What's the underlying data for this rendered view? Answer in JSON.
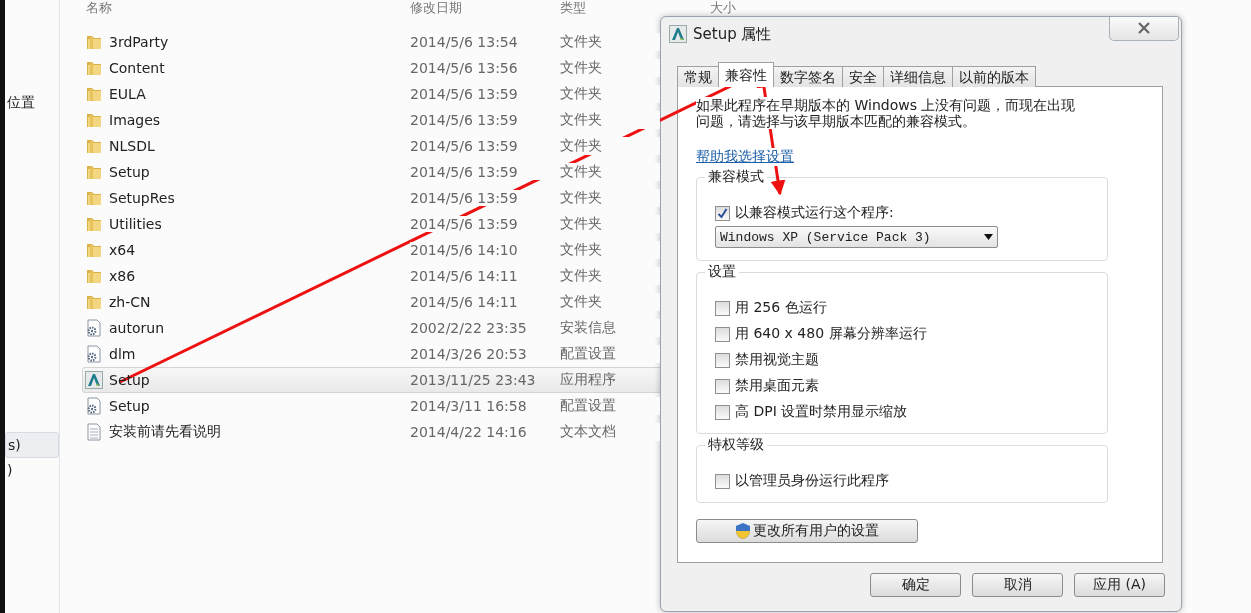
{
  "sidebar": {
    "items": [
      {
        "label": "位置",
        "selected": false
      },
      {
        "label": "s)",
        "selected": true
      },
      {
        "label": ")",
        "selected": false
      }
    ]
  },
  "file_list": {
    "columns": [
      "名称",
      "修改日期",
      "类型",
      "大小"
    ],
    "rows": [
      {
        "kind": "folder",
        "name": "3rdParty",
        "modified": "2014/5/6 13:54",
        "type": "文件夹",
        "selected": false
      },
      {
        "kind": "folder",
        "name": "Content",
        "modified": "2014/5/6 13:56",
        "type": "文件夹",
        "selected": false
      },
      {
        "kind": "folder",
        "name": "EULA",
        "modified": "2014/5/6 13:59",
        "type": "文件夹",
        "selected": false
      },
      {
        "kind": "folder",
        "name": "Images",
        "modified": "2014/5/6 13:59",
        "type": "文件夹",
        "selected": false
      },
      {
        "kind": "folder",
        "name": "NLSDL",
        "modified": "2014/5/6 13:59",
        "type": "文件夹",
        "selected": false
      },
      {
        "kind": "folder",
        "name": "Setup",
        "modified": "2014/5/6 13:59",
        "type": "文件夹",
        "selected": false
      },
      {
        "kind": "folder",
        "name": "SetupRes",
        "modified": "2014/5/6 13:59",
        "type": "文件夹",
        "selected": false
      },
      {
        "kind": "folder",
        "name": "Utilities",
        "modified": "2014/5/6 13:59",
        "type": "文件夹",
        "selected": false
      },
      {
        "kind": "folder",
        "name": "x64",
        "modified": "2014/5/6 14:10",
        "type": "文件夹",
        "selected": false
      },
      {
        "kind": "folder",
        "name": "x86",
        "modified": "2014/5/6 14:11",
        "type": "文件夹",
        "selected": false
      },
      {
        "kind": "folder",
        "name": "zh-CN",
        "modified": "2014/5/6 14:11",
        "type": "文件夹",
        "selected": false
      },
      {
        "kind": "config",
        "name": "autorun",
        "modified": "2002/2/22 23:35",
        "type": "安装信息",
        "selected": false
      },
      {
        "kind": "config",
        "name": "dlm",
        "modified": "2014/3/26 20:53",
        "type": "配置设置",
        "selected": false
      },
      {
        "kind": "app",
        "name": "Setup",
        "modified": "2013/11/25 23:43",
        "type": "应用程序",
        "selected": true
      },
      {
        "kind": "config",
        "name": "Setup",
        "modified": "2014/3/11 16:58",
        "type": "配置设置",
        "selected": false
      },
      {
        "kind": "text",
        "name": "安装前请先看说明",
        "modified": "2014/4/22 14:16",
        "type": "文本文档",
        "selected": false
      }
    ]
  },
  "dialog": {
    "title": "Setup 属性",
    "tabs": [
      {
        "label": "常规",
        "selected": false
      },
      {
        "label": "兼容性",
        "selected": true
      },
      {
        "label": "数字签名",
        "selected": false
      },
      {
        "label": "安全",
        "selected": false
      },
      {
        "label": "详细信息",
        "selected": false
      },
      {
        "label": "以前的版本",
        "selected": false
      }
    ],
    "description": "如果此程序在早期版本的 Windows 上没有问题，而现在出现问题，请选择与该早期版本匹配的兼容模式。",
    "help_link": "帮助我选择设置",
    "groups": [
      {
        "title": "兼容模式",
        "options": [
          {
            "label": "以兼容模式运行这个程序:",
            "checked": true
          }
        ],
        "dropdown": {
          "value": "Windows XP (Service Pack 3)"
        }
      },
      {
        "title": "设置",
        "options": [
          {
            "label": "用 256 色运行",
            "checked": false
          },
          {
            "label": "用 640 x 480 屏幕分辨率运行",
            "checked": false
          },
          {
            "label": "禁用视觉主题",
            "checked": false
          },
          {
            "label": "禁用桌面元素",
            "checked": false
          },
          {
            "label": "高 DPI 设置时禁用显示缩放",
            "checked": false
          }
        ]
      },
      {
        "title": "特权等级",
        "options": [
          {
            "label": "以管理员身份运行此程序",
            "checked": false
          }
        ]
      }
    ],
    "shield_button": "更改所有用户的设置",
    "buttons": [
      "确定",
      "取消",
      "应用 (A)"
    ]
  }
}
